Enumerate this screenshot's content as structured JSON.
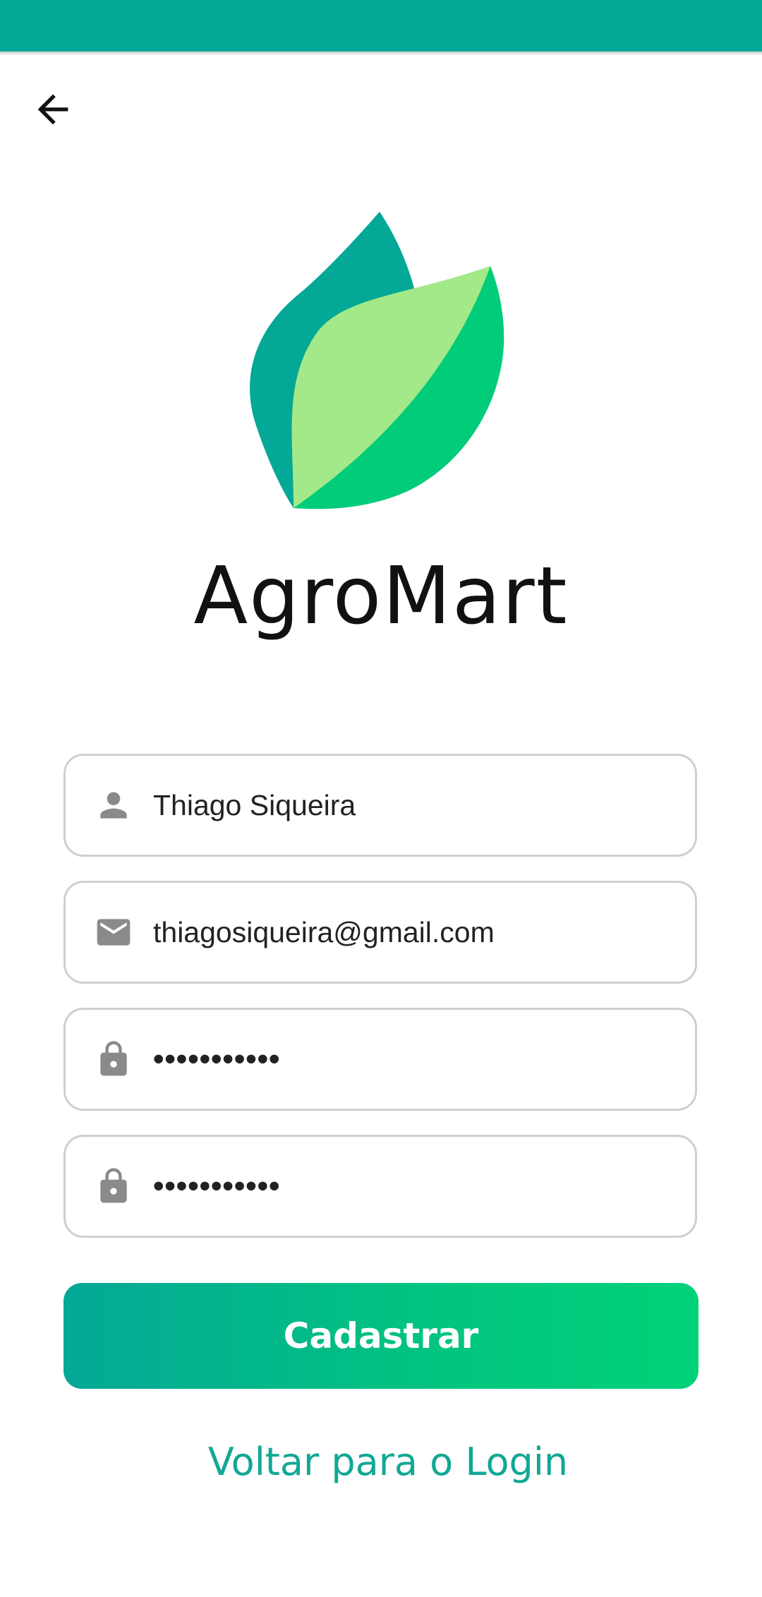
{
  "app": {
    "title": "AgroMart"
  },
  "form": {
    "name": {
      "value": "Thiago Siqueira",
      "icon": "person-icon"
    },
    "email": {
      "value": "thiagosiqueira@gmail.com",
      "icon": "mail-icon"
    },
    "password": {
      "value": "•••••••••••",
      "icon": "lock-icon"
    },
    "confirm_password": {
      "value": "•••••••••••",
      "icon": "lock-icon"
    }
  },
  "actions": {
    "submit_label": "Cadastrar",
    "login_link": "Voltar para o Login",
    "back_icon": "arrow-left-icon"
  },
  "colors": {
    "primary": "#03a896",
    "accent": "#00d279",
    "leaf_light": "#a3e989",
    "icon_gray": "#8a8a8a",
    "field_border": "#cfcfcf"
  }
}
